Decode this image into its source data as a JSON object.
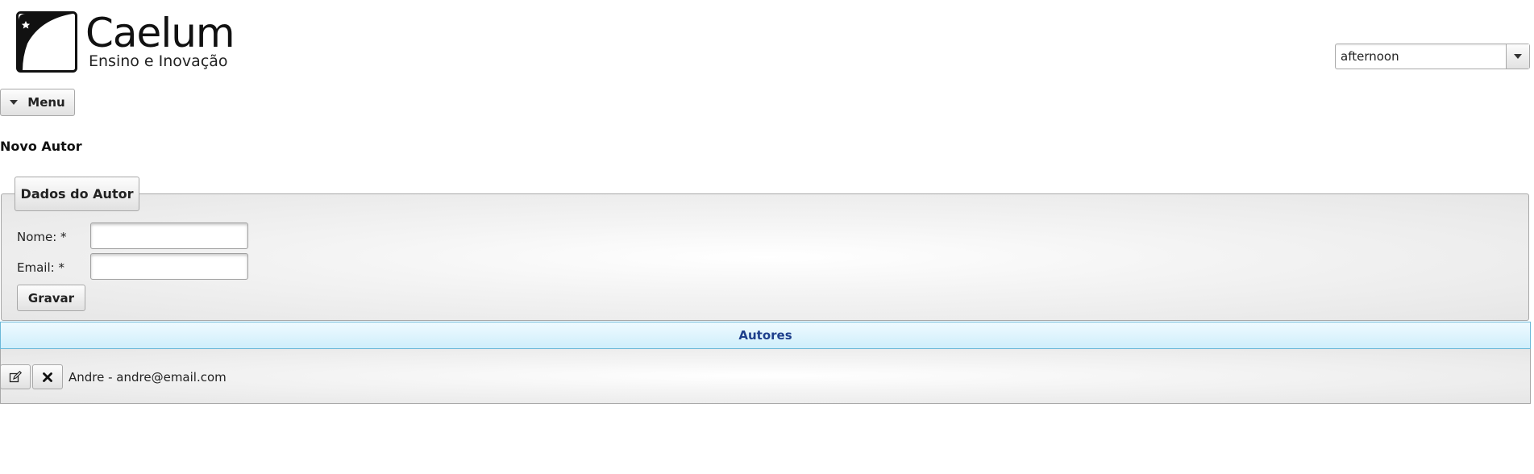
{
  "header": {
    "logo_name": "Caelum",
    "logo_tagline": "Ensino e Inovação",
    "theme_selected": "afternoon"
  },
  "menu": {
    "label": "Menu"
  },
  "page": {
    "title": "Novo Autor"
  },
  "form": {
    "legend": "Dados do Autor",
    "nome_label": "Nome: *",
    "nome_value": "",
    "email_label": "Email: *",
    "email_value": "",
    "submit_label": "Gravar"
  },
  "autores": {
    "header": "Autores",
    "rows": [
      {
        "text": "Andre - andre@email.com",
        "edit_icon": "edit-icon",
        "delete_icon": "close-icon"
      }
    ]
  },
  "colors": {
    "panel_header_text": "#1e3f8c",
    "panel_header_border": "#6bb8d8"
  }
}
